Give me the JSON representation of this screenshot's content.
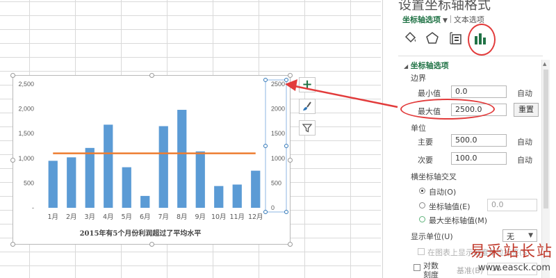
{
  "pane": {
    "title": "设置坐标轴格式",
    "tab_axis_options": "坐标轴选项",
    "tab_dropdown": "▼",
    "tab_text_options": "文本选项",
    "icons": [
      "fill-bucket-icon",
      "pentagon-shape-icon",
      "size-properties-icon",
      "bar-chart-icon"
    ],
    "section_axis_options": "坐标轴选项",
    "bounds_label": "边界",
    "min_label": "最小值",
    "min_value": "0.0",
    "min_auto": "自动",
    "max_label": "最大值",
    "max_value": "2500.0",
    "reset_label": "重置",
    "units_label": "单位",
    "major_label": "主要",
    "major_value": "500.0",
    "major_auto": "自动",
    "minor_label": "次要",
    "minor_value": "100.0",
    "minor_auto": "自动",
    "cross_label": "横坐标轴交叉",
    "cross_auto": "自动(O)",
    "cross_value_label": "坐标轴值(E)",
    "cross_value": "0.0",
    "cross_max": "最大坐标轴值(M)",
    "display_units_label": "显示单位(U)",
    "display_units_value": "无",
    "show_units_label": "在图表上显示刻度单位标签(S)",
    "log_label": "对数刻度(L)",
    "log_base_label": "基准(B)",
    "log_base_value": "10"
  },
  "chart_buttons": {
    "add_element": "+",
    "style": "chart-style-brush-icon",
    "filter": "chart-filter-icon"
  },
  "watermark": {
    "cn": "易采站长站",
    "url": "www.easck.com"
  },
  "colors": {
    "bar": "#5b9bd5",
    "line": "#ed7d31",
    "accent_green": "#217346",
    "annotation_red": "#e23b3b"
  },
  "chart_data": {
    "type": "bar",
    "title": "2015年有5个月份利润超过了平均水平",
    "categories": [
      "1月",
      "2月",
      "3月",
      "4月",
      "5月",
      "6月",
      "7月",
      "8月",
      "9月",
      "10月",
      "11月",
      "12月"
    ],
    "values": [
      950,
      1020,
      1210,
      1680,
      820,
      240,
      1650,
      1980,
      1140,
      440,
      470,
      750
    ],
    "average_line": 1100,
    "y_left_ticks": [
      "-",
      "500",
      "1,000",
      "1,500",
      "2,000",
      "2,500"
    ],
    "y_right_ticks": [
      "0",
      "500",
      "1000",
      "1500",
      "2000",
      "2500"
    ],
    "ylim": [
      0,
      2500
    ],
    "grid": false,
    "legend": "none"
  }
}
